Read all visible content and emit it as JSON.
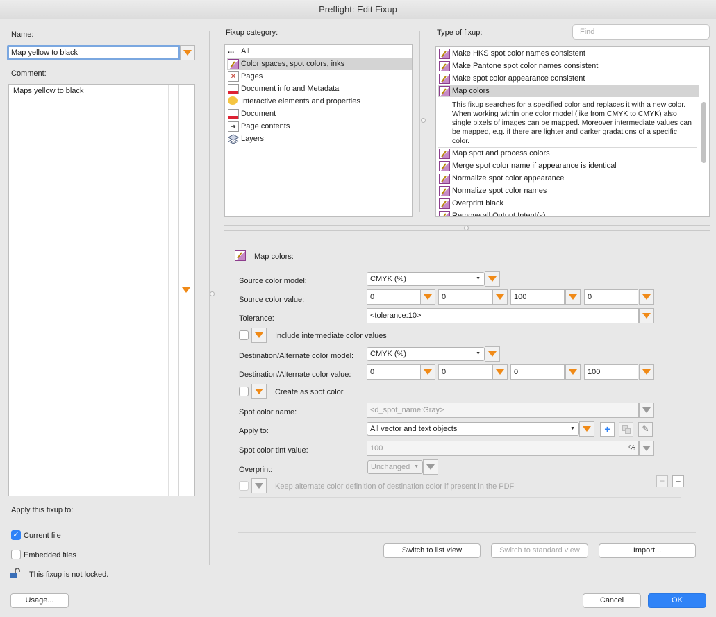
{
  "window": {
    "title": "Preflight: Edit Fixup"
  },
  "left": {
    "name_label": "Name:",
    "name_value": "Map yellow to black",
    "comment_label": "Comment:",
    "comment_value": "Maps yellow to black",
    "apply_label": "Apply this fixup to:",
    "current_file": "Current file",
    "current_file_checked": true,
    "embedded_files": "Embedded files",
    "embedded_files_checked": false,
    "lock_text": "This fixup is not locked.",
    "usage_button": "Usage..."
  },
  "category": {
    "label": "Fixup category:",
    "items": [
      {
        "label": "All",
        "icon": "ellipsis-icon"
      },
      {
        "label": "Color spaces, spot colors, inks",
        "icon": "color-fixup-icon",
        "selected": true
      },
      {
        "label": "Pages",
        "icon": "pdf-page-icon"
      },
      {
        "label": "Document info and Metadata",
        "icon": "document-info-icon"
      },
      {
        "label": "Interactive elements and properties",
        "icon": "comment-bubble-icon"
      },
      {
        "label": "Document",
        "icon": "document-icon"
      },
      {
        "label": "Page contents",
        "icon": "page-contents-icon"
      },
      {
        "label": "Layers",
        "icon": "layers-icon"
      }
    ]
  },
  "type": {
    "label": "Type of fixup:",
    "find_placeholder": "Find",
    "items": [
      {
        "label": "Make HKS spot color names consistent"
      },
      {
        "label": "Make Pantone spot color names consistent"
      },
      {
        "label": "Make spot color appearance consistent"
      },
      {
        "label": "Map colors",
        "selected": true
      },
      {
        "label": "Map spot and process colors"
      },
      {
        "label": "Merge spot color name if appearance is identical"
      },
      {
        "label": "Normalize spot color appearance"
      },
      {
        "label": "Normalize spot color names"
      },
      {
        "label": "Overprint black"
      },
      {
        "label": "Remove all Output Intent(s)"
      }
    ],
    "description": "This fixup searches for a specified color and replaces it with a new color. When working within one color model (like from CMYK to CMYK) also single pixels of images can be mapped. Moreover intermediate values can be mapped, e.g. if there are lighter and darker gradations of a specific color."
  },
  "form": {
    "header": "Map colors:",
    "source_model_label": "Source color model:",
    "source_model_value": "CMYK (%)",
    "source_value_label": "Source color value:",
    "source_values": [
      "0",
      "0",
      "100",
      "0"
    ],
    "tolerance_label": "Tolerance:",
    "tolerance_value": "<tolerance:10>",
    "intermediate_label": "Include intermediate color values",
    "dest_model_label": "Destination/Alternate color model:",
    "dest_model_value": "CMYK (%)",
    "dest_value_label": "Destination/Alternate color value:",
    "dest_values": [
      "0",
      "0",
      "0",
      "100"
    ],
    "create_spot_label": "Create as spot color",
    "spot_name_label": "Spot color name:",
    "spot_name_value": "<d_spot_name:Gray>",
    "apply_to_label": "Apply to:",
    "apply_to_value": "All vector and text objects",
    "tint_label": "Spot color tint value:",
    "tint_value": "100",
    "tint_unit": "%",
    "overprint_label": "Overprint:",
    "overprint_value": "Unchanged",
    "keep_alternate_label": "Keep alternate color definition of destination color if present in the PDF",
    "minus": "−",
    "plus": "+"
  },
  "buttons": {
    "list_view": "Switch to list view",
    "standard_view": "Switch to standard view",
    "import": "Import...",
    "cancel": "Cancel",
    "ok": "OK"
  },
  "colors": {
    "accent": "#2f83f7",
    "orange": "#f08a17",
    "selection": "#d4d4d4"
  }
}
